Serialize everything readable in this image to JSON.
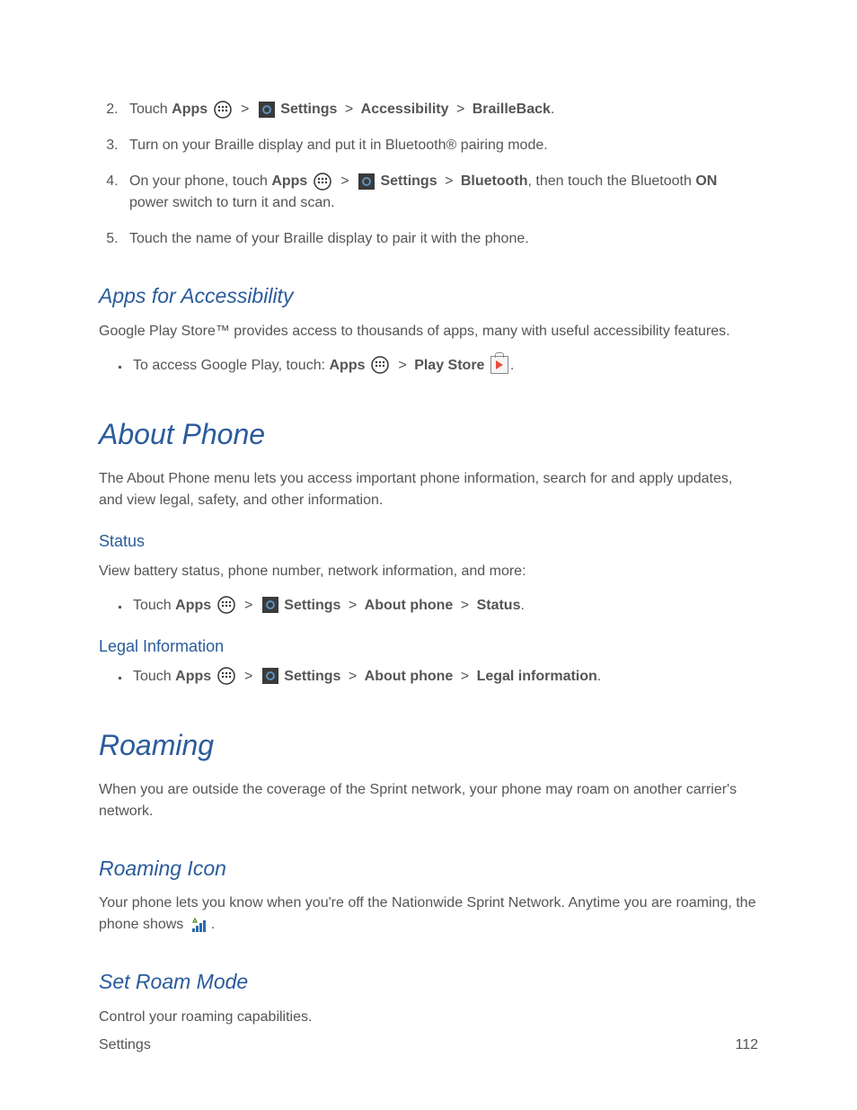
{
  "steps": {
    "s2_a": "Touch ",
    "s2_apps": "Apps",
    "s2_settings": "Settings",
    "s2_accessibility": "Accessibility",
    "s2_brailleback": "BrailleBack",
    "s3": "Turn on your Braille display and put it in Bluetooth® pairing mode.",
    "s4_a": "On your phone, touch ",
    "s4_apps": "Apps",
    "s4_settings": "Settings",
    "s4_bluetooth": "Bluetooth",
    "s4_b": ", then touch the Bluetooth ",
    "s4_on": "ON",
    "s4_c": " power switch to turn it and scan.",
    "s5": "Touch the name of your Braille display to pair it with the phone."
  },
  "h2_apps_access": "Apps for Accessibility",
  "p_google_play": "Google Play Store™ provides access to thousands of apps, many with useful accessibility features.",
  "bullet_play_a": "To access Google Play, touch: ",
  "bullet_play_apps": "Apps",
  "bullet_play_store": "Play Store",
  "h1_about": "About Phone",
  "p_about": "The About Phone menu lets you access important phone information, search for and apply updates, and view legal, safety, and other information.",
  "h3_status": "Status",
  "p_status": "View battery status, phone number, network information, and more:",
  "bullet_status_a": "Touch ",
  "bullet_status_apps": "Apps",
  "bullet_status_settings": "Settings",
  "bullet_status_about": "About phone",
  "bullet_status_status": "Status",
  "h3_legal": "Legal Information",
  "bullet_legal_a": "Touch ",
  "bullet_legal_apps": "Apps",
  "bullet_legal_settings": "Settings",
  "bullet_legal_about": "About phone",
  "bullet_legal_legal": "Legal information",
  "h1_roaming": "Roaming",
  "p_roaming": "When you are outside the coverage of the Sprint network, your phone may roam on another carrier's network.",
  "h2_roaming_icon": "Roaming Icon",
  "p_roaming_icon_a": "Your phone lets you know when you're off the Nationwide Sprint Network. Anytime you are roaming, the phone shows ",
  "h2_roam_mode": "Set Roam Mode",
  "p_roam_mode": "Control your roaming capabilities.",
  "footer_left": "Settings",
  "footer_right": "112",
  "period": ".",
  "gt": ">"
}
